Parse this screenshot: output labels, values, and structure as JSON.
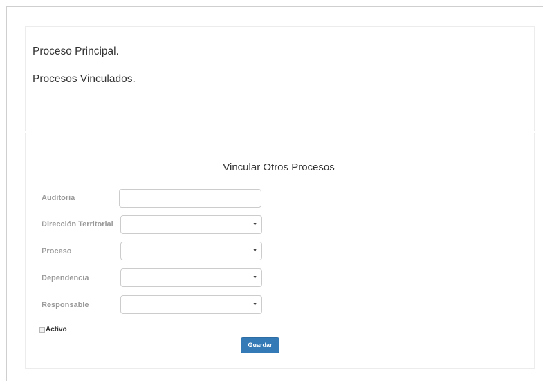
{
  "sections": {
    "main_process": "Proceso Principal.",
    "linked_processes": "Procesos Vinculados."
  },
  "form": {
    "title": "Vincular Otros Procesos",
    "fields": {
      "auditoria": {
        "label": "Auditoria",
        "value": ""
      },
      "direccion_territorial": {
        "label": "Dirección Territorial",
        "value": ""
      },
      "proceso": {
        "label": "Proceso",
        "value": ""
      },
      "dependencia": {
        "label": "Dependencia",
        "value": ""
      },
      "responsable": {
        "label": "Responsable",
        "value": ""
      }
    },
    "activo": {
      "label": "Activo",
      "checked": false
    },
    "submit_label": "Guardar"
  },
  "icons": {
    "select_caret": "chevron-down-icon",
    "caret_glyph": "▼"
  },
  "colors": {
    "primary_button": "#337ab7",
    "label_text": "#9a9a9a",
    "heading_text": "#333333"
  }
}
